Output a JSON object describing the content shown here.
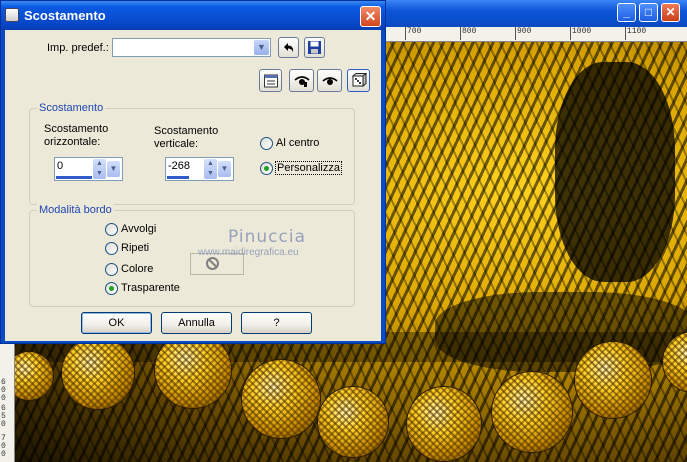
{
  "dialog": {
    "title": "Scostamento",
    "close_glyph": "✕",
    "preset": {
      "label": "Imp. predef.:",
      "value": ""
    },
    "offset_group": {
      "title": "Scostamento",
      "horizontal": {
        "label_line1": "Scostamento",
        "label_line2": "orizzontale:",
        "value": "0"
      },
      "vertical": {
        "label_line1": "Scostamento",
        "label_line2": "verticale:",
        "value": "-268"
      },
      "options": [
        {
          "label": "Al centro",
          "selected": false
        },
        {
          "label": "Personalizza",
          "selected": true
        }
      ]
    },
    "edge_group": {
      "title": "Modalità bordo",
      "options": [
        {
          "label": "Avvolgi",
          "selected": false
        },
        {
          "label": "Ripeti",
          "selected": false
        },
        {
          "label": "Colore",
          "selected": false
        },
        {
          "label": "Trasparente",
          "selected": true
        }
      ]
    },
    "buttons": {
      "ok": "OK",
      "cancel": "Annulla",
      "help": "?"
    }
  },
  "watermark": {
    "title": "Pinuccia",
    "url": "www.maidiregrafica.eu"
  },
  "image_window": {
    "ruler_top": [
      "700",
      "800",
      "900",
      "1000",
      "1100"
    ],
    "ruler_left": [
      "6",
      "0",
      "0",
      "6",
      "5",
      "0",
      "7",
      "0",
      "0"
    ]
  },
  "icons": {
    "preset_dropdown": "chevron-down-icon",
    "undo": "undo-arrow-icon",
    "save": "floppy-save-icon",
    "reset": "reset-dialog-icon",
    "eye_open": "eye-preview-icon",
    "eye_closed": "eye-closed-icon",
    "randomize": "dice-icon"
  },
  "colors": {
    "title_bar": "#0a4ac2",
    "dialog_bg": "#ece9d8",
    "group_title": "#1e46b4",
    "close": "#d2461e"
  }
}
